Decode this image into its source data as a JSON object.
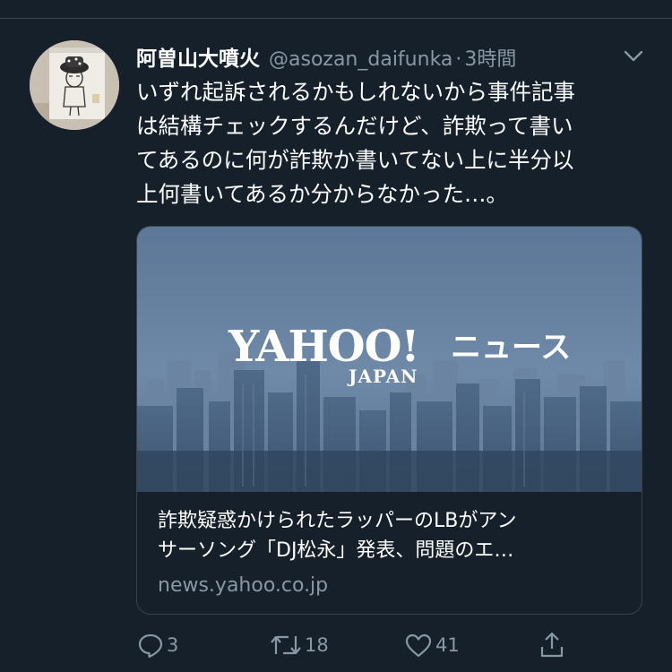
{
  "tweet": {
    "display_name": "阿曽山大噴火",
    "handle": "@asozan_daifunka",
    "separator": "·",
    "time": "3時間",
    "text_lines": [
      "いずれ起訴されるかもしれないから事件記事",
      "は結構チェックするんだけど、詐欺って書い",
      "てあるのに何が詐欺か書いてない上に半分以",
      "上何書いてあるか分からなかった…。"
    ]
  },
  "card": {
    "image_logo": {
      "wordmark": "YAHOO!",
      "region": "JAPAN",
      "service": "ニュース"
    },
    "title_lines": [
      "詐欺疑惑かけられたラッパーのLBがアン",
      "サーソング「DJ松永」発表、問題のエ…"
    ],
    "domain": "news.yahoo.co.jp"
  },
  "actions": {
    "reply_count": "3",
    "retweet_count": "18",
    "like_count": "41"
  },
  "icons": {
    "more": "chevron-down-icon",
    "reply": "reply-icon",
    "retweet": "retweet-icon",
    "like": "heart-icon",
    "share": "share-icon"
  },
  "colors": {
    "background": "#15202b",
    "secondary_text": "#8899a6",
    "border": "#38444d"
  }
}
